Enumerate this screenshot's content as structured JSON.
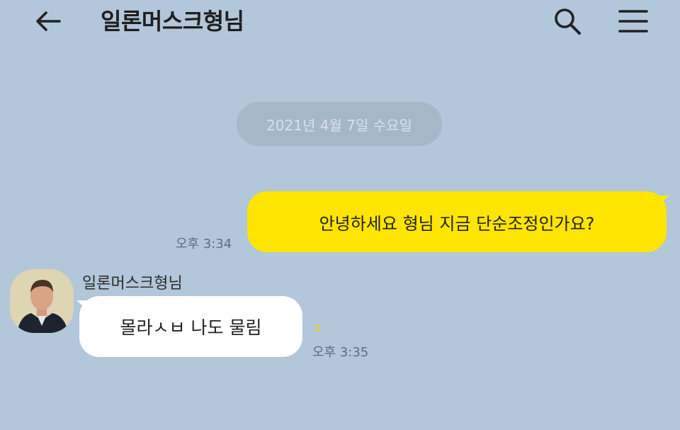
{
  "header": {
    "title": "일론머스크형님",
    "back_icon": "arrow-left-icon",
    "search_icon": "search-icon",
    "menu_icon": "hamburger-menu-icon"
  },
  "chat": {
    "date_divider": "2021년 4월 7일 수요일",
    "messages": [
      {
        "direction": "outgoing",
        "text": "안녕하세요 형님 지금 단순조정인가요?",
        "time": "오후 3:34"
      },
      {
        "direction": "incoming",
        "sender": "일론머스크형님",
        "text": "몰라ㅅㅂ 나도 물림",
        "time": "오후 3:35",
        "unread": "1"
      }
    ]
  },
  "colors": {
    "background": "#b2c7d9",
    "outgoing_bubble": "#fee500",
    "incoming_bubble": "#ffffff",
    "date_pill": "#a5b8c8"
  }
}
